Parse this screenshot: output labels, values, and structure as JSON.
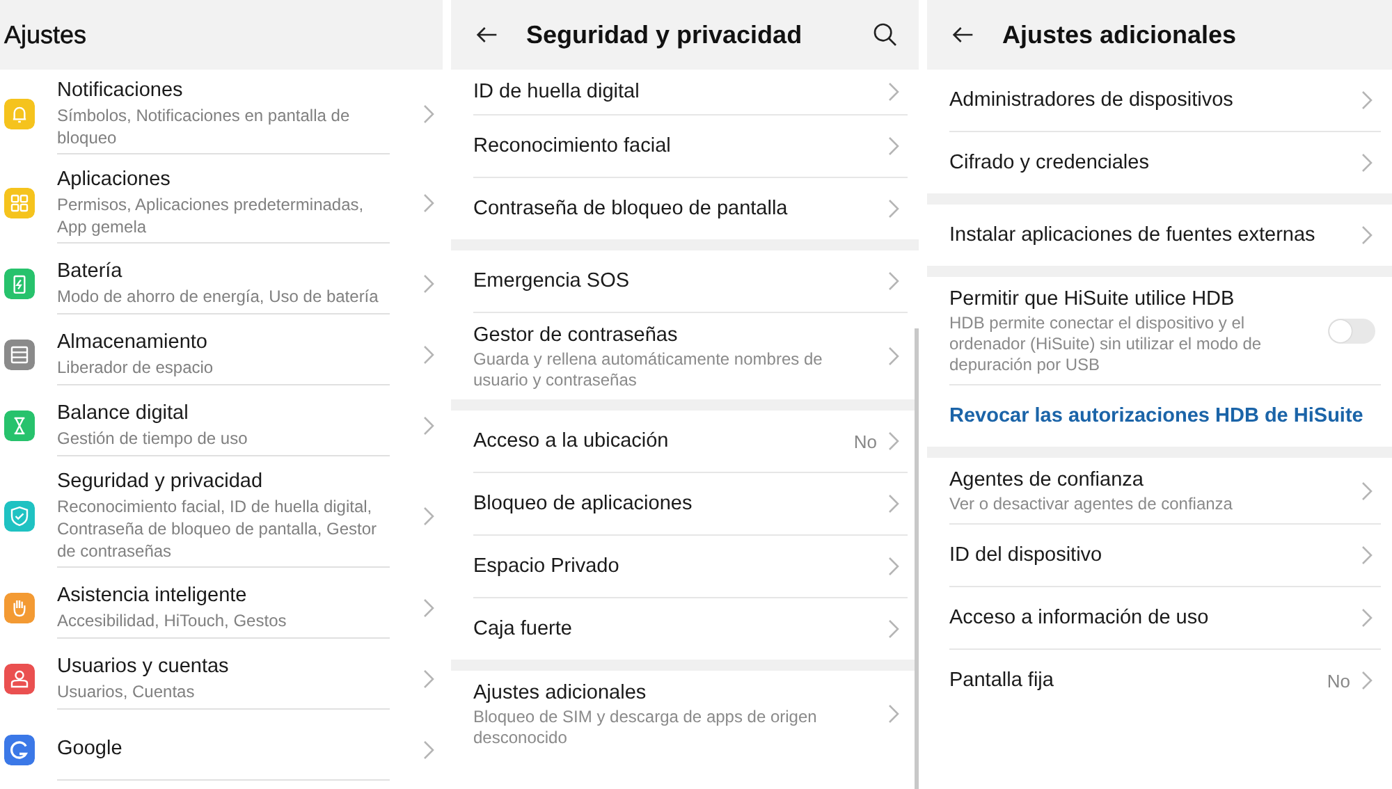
{
  "main_settings": {
    "title": "Ajustes",
    "items": [
      {
        "title": "Notificaciones",
        "subtitle": "Símbolos, Notificaciones en pantalla de bloqueo",
        "color": "#f5c31d"
      },
      {
        "title": "Aplicaciones",
        "subtitle": "Permisos, Aplicaciones predeterminadas, App gemela",
        "color": "#f5c31d"
      },
      {
        "title": "Batería",
        "subtitle": "Modo de ahorro de energía, Uso de batería",
        "color": "#27c26c"
      },
      {
        "title": "Almacenamiento",
        "subtitle": "Liberador de espacio",
        "color": "#8a8a8a"
      },
      {
        "title": "Balance digital",
        "subtitle": "Gestión de tiempo de uso",
        "color": "#27c26c"
      },
      {
        "title": "Seguridad y privacidad",
        "subtitle": "Reconocimiento facial, ID de huella digital, Contraseña de bloqueo de pantalla, Gestor de contraseñas",
        "color": "#1fc2c2"
      },
      {
        "title": "Asistencia inteligente",
        "subtitle": "Accesibilidad, HiTouch, Gestos",
        "color": "#f39a33"
      },
      {
        "title": "Usuarios y cuentas",
        "subtitle": "Usuarios, Cuentas",
        "color": "#ea5050"
      },
      {
        "title": "Google",
        "color": "#3b78e7"
      }
    ]
  },
  "security": {
    "title": "Seguridad y privacidad",
    "groups": [
      {
        "items": [
          {
            "kind": "nav",
            "title": "ID de huella digital"
          },
          {
            "kind": "nav",
            "title": "Reconocimiento facial"
          },
          {
            "kind": "nav",
            "title": "Contraseña de bloqueo de pantalla"
          }
        ]
      },
      {
        "items": [
          {
            "kind": "nav",
            "title": "Emergencia SOS"
          },
          {
            "kind": "nav",
            "title": "Gestor de contraseñas",
            "subtitle": "Guarda y rellena automáticamente nombres de usuario y contraseñas"
          }
        ]
      },
      {
        "items": [
          {
            "kind": "nav",
            "title": "Acceso a la ubicación",
            "value": "No"
          },
          {
            "kind": "nav",
            "title": "Bloqueo de aplicaciones"
          },
          {
            "kind": "nav",
            "title": "Espacio Privado"
          },
          {
            "kind": "nav",
            "title": "Caja fuerte"
          }
        ]
      },
      {
        "items": [
          {
            "kind": "nav",
            "title": "Ajustes adicionales",
            "subtitle": "Bloqueo de SIM y descarga de apps de origen desconocido"
          }
        ]
      }
    ]
  },
  "additional": {
    "title": "Ajustes adicionales",
    "groups": [
      {
        "items": [
          {
            "kind": "nav",
            "title": "Administradores de dispositivos"
          },
          {
            "kind": "nav",
            "title": "Cifrado y credenciales"
          }
        ]
      },
      {
        "items": [
          {
            "kind": "nav",
            "title": "Instalar aplicaciones de fuentes externas"
          }
        ]
      },
      {
        "items": [
          {
            "kind": "toggle",
            "title": "Permitir que HiSuite utilice HDB",
            "subtitle": "HDB permite conectar el dispositivo y el ordenador (HiSuite) sin utilizar el modo de depuración por USB",
            "on": false
          },
          {
            "kind": "link",
            "title": "Revocar las autorizaciones HDB de HiSuite"
          }
        ]
      },
      {
        "items": [
          {
            "kind": "nav",
            "title": "Agentes de confianza",
            "subtitle": "Ver o desactivar agentes de confianza"
          },
          {
            "kind": "nav",
            "title": "ID del dispositivo"
          },
          {
            "kind": "nav",
            "title": "Acceso a información de uso"
          },
          {
            "kind": "nav",
            "title": "Pantalla fija",
            "value": "No"
          }
        ]
      }
    ]
  }
}
